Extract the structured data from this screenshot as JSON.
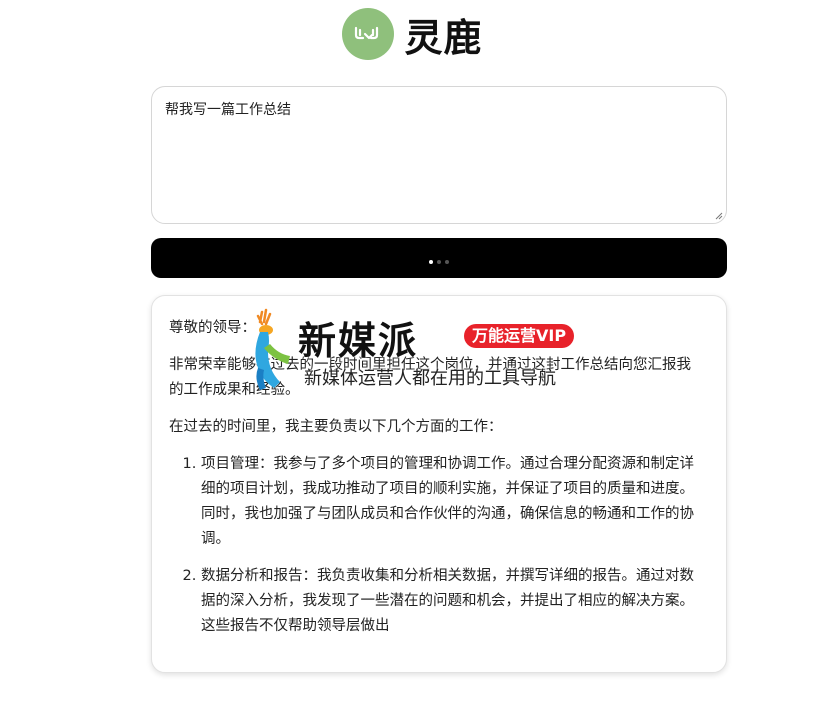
{
  "header": {
    "logo_icon": "deer-antler-icon",
    "logo_color": "#8fc07c",
    "title": "灵鹿"
  },
  "prompt": {
    "value": "帮我写一篇工作总结"
  },
  "generate": {
    "state": "loading",
    "color": "#000000"
  },
  "result": {
    "greeting": "尊敬的领导：",
    "intro": "非常荣幸能够在过去的一段时间里担任这个岗位，并通过这封工作总结向您汇报我的工作成果和经验。",
    "lead": "在过去的时间里，我主要负责以下几个方面的工作：",
    "items": [
      "项目管理：我参与了多个项目的管理和协调工作。通过合理分配资源和制定详细的项目计划，我成功推动了项目的顺利实施，并保证了项目的质量和进度。同时，我也加强了与团队成员和合作伙伴的沟通，确保信息的畅通和工作的协调。",
      "数据分析和报告：我负责收集和分析相关数据，并撰写详细的报告。通过对数据的深入分析，我发现了一些潜在的问题和机会，并提出了相应的解决方案。这些报告不仅帮助领导层做出"
    ]
  },
  "watermark": {
    "title": "新媒派",
    "badge": "万能运营VIP",
    "subtitle": "新媒体运营人都在用的工具导航",
    "badge_color": "#e8222a"
  }
}
